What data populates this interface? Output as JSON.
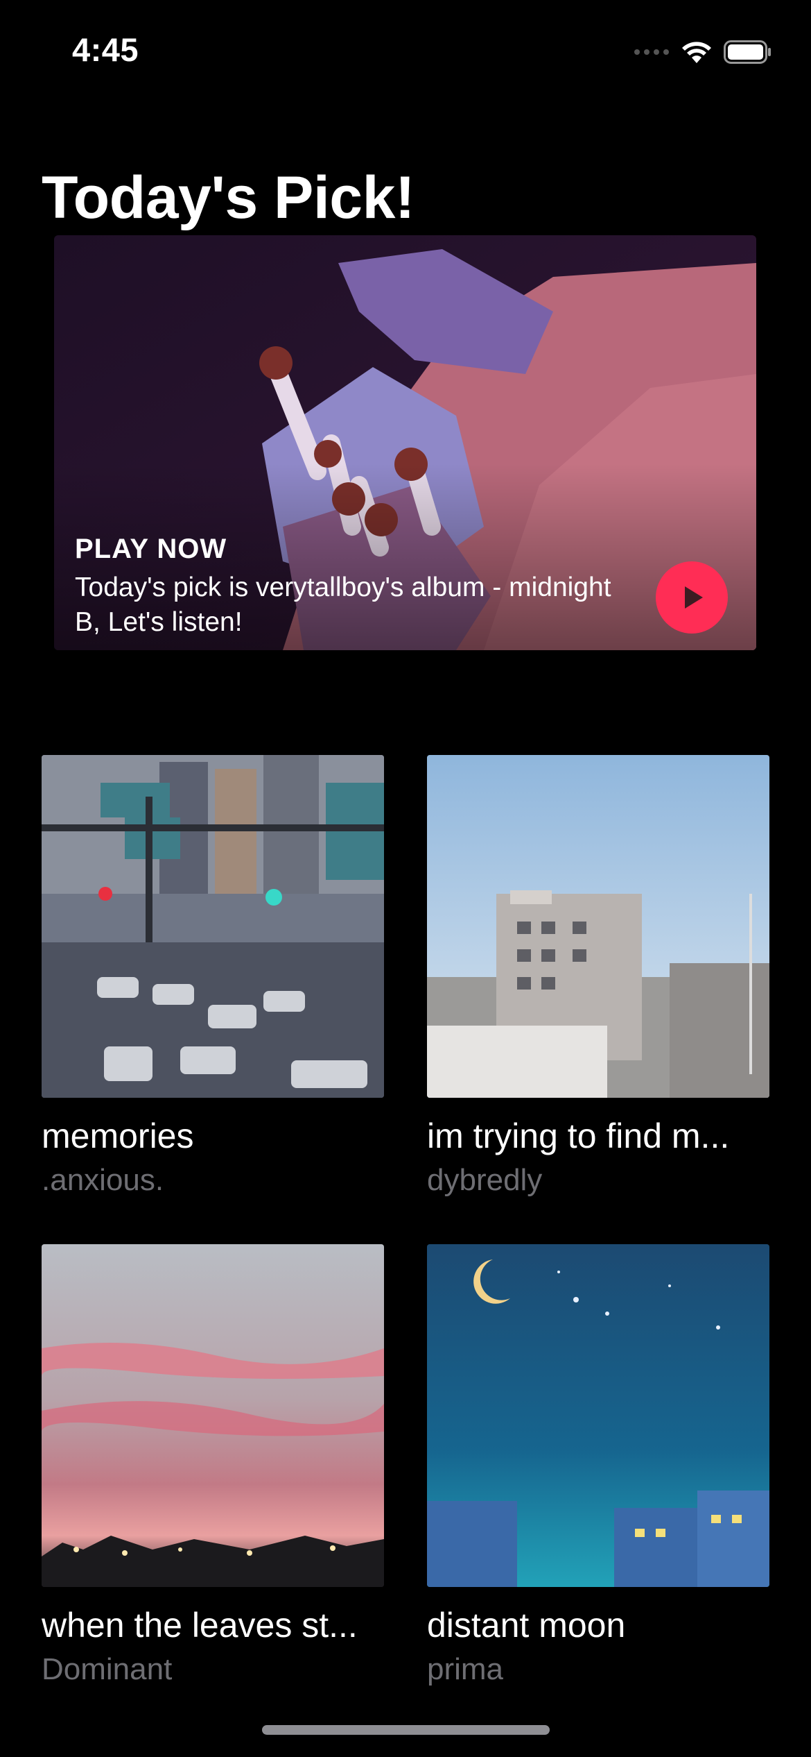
{
  "status_bar": {
    "time": "4:45",
    "icons": [
      "cellular-icon",
      "wifi-icon",
      "battery-icon"
    ]
  },
  "page": {
    "title": "Today's Pick!"
  },
  "featured": {
    "label": "PLAY NOW",
    "description": "Today's pick is verytallboy's album - midnight B, Let's listen!",
    "play_icon": "play-icon",
    "accent_color": "#ff2d55"
  },
  "albums": [
    {
      "title": "memories",
      "artist": ".anxious."
    },
    {
      "title": "im trying to find m...",
      "artist": "dybredly"
    },
    {
      "title": "when the leaves st...",
      "artist": "Dominant"
    },
    {
      "title": "distant moon",
      "artist": "prima"
    }
  ],
  "colors": {
    "background": "#000000",
    "secondary_text": "#6e6e73"
  }
}
